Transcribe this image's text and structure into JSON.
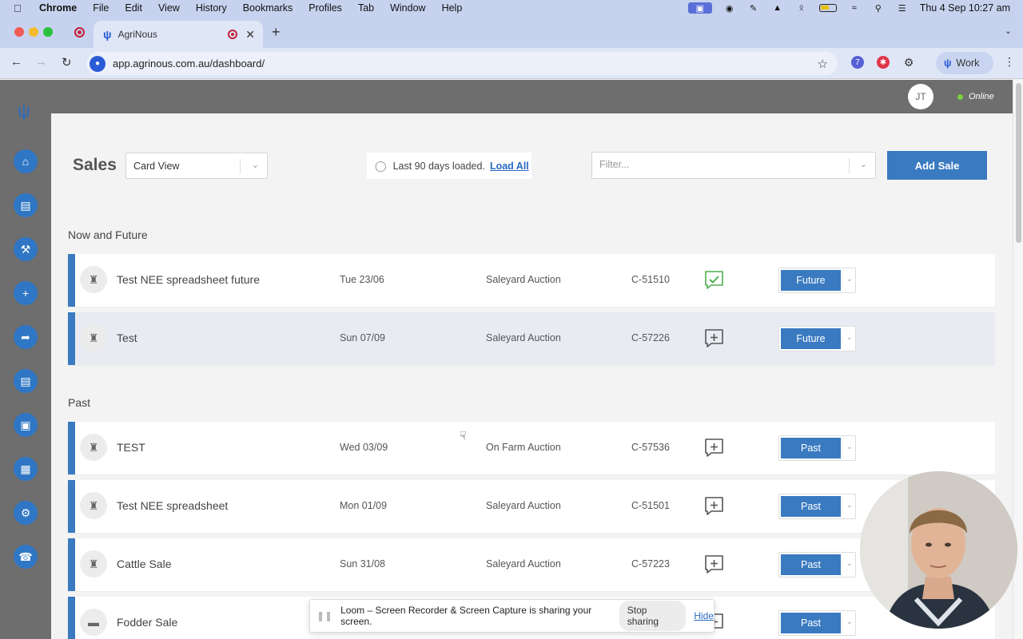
{
  "menubar": {
    "app": "Chrome",
    "items": [
      "File",
      "Edit",
      "View",
      "History",
      "Bookmarks",
      "Profiles",
      "Tab",
      "Window",
      "Help"
    ],
    "clock": "Thu 4 Sep  10:27 am"
  },
  "browser": {
    "tab_title": "AgriNous",
    "url": "app.agrinous.com.au/dashboard/",
    "profile_label": "Work",
    "ext_badge": "7"
  },
  "app": {
    "user_initials": "JT",
    "status": "Online",
    "page_title": "Sales",
    "view_select": "Card View",
    "notice_text": "Last 90 days loaded.",
    "notice_link": "Load All",
    "filter_placeholder": "Filter...",
    "add_button": "Add Sale",
    "sections": {
      "now": "Now and Future",
      "past": "Past"
    },
    "rows": [
      {
        "name": "Test NEE spreadsheet future",
        "date": "Tue 23/06",
        "type": "Saleyard Auction",
        "code": "C-51510",
        "status": "Future",
        "comment": "checked",
        "icon": "cattle-icon"
      },
      {
        "name": "Test",
        "date": "Sun 07/09",
        "type": "Saleyard Auction",
        "code": "C-57226",
        "status": "Future",
        "comment": "add",
        "icon": "cattle-icon"
      },
      {
        "name": "TEST",
        "date": "Wed 03/09",
        "type": "On Farm Auction",
        "code": "C-57536",
        "status": "Past",
        "comment": "add",
        "icon": "cattle-icon"
      },
      {
        "name": "Test NEE spreadsheet",
        "date": "Mon 01/09",
        "type": "Saleyard Auction",
        "code": "C-51501",
        "status": "Past",
        "comment": "add",
        "icon": "cattle-icon"
      },
      {
        "name": "Cattle Sale",
        "date": "Sun 31/08",
        "type": "Saleyard Auction",
        "code": "C-57223",
        "status": "Past",
        "comment": "add",
        "icon": "cattle-icon"
      },
      {
        "name": "Fodder Sale",
        "date": "",
        "type": "",
        "code": "",
        "status": "Past",
        "comment": "add",
        "icon": "fodder-icon"
      }
    ]
  },
  "loom": {
    "message": "Loom – Screen Recorder & Screen Capture is sharing your screen.",
    "stop": "Stop sharing",
    "hide": "Hide"
  },
  "colors": {
    "accent": "#3a7ac1",
    "nav_bg": "#6e6e6e",
    "check_green": "#4caf50"
  }
}
